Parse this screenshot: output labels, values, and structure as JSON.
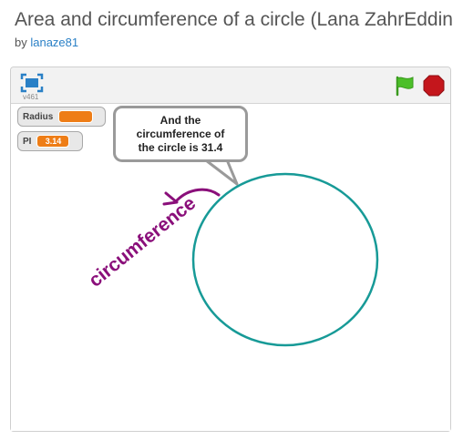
{
  "project": {
    "title": "Area and circumference of a circle (Lana ZahrEddine)",
    "by_prefix": "by ",
    "author": "lanaze81"
  },
  "player": {
    "version": "v461",
    "icons": {
      "fullscreen": "fullscreen-icon",
      "green_flag": "green-flag-icon",
      "stop": "stop-icon"
    }
  },
  "stage": {
    "monitors": [
      {
        "label": "Radius",
        "value": ""
      },
      {
        "label": "PI",
        "value": "3.14"
      }
    ],
    "speech": {
      "line1": "And the",
      "line2": "circumference of",
      "line3": "the circle is 31.4"
    },
    "drawing_label": "circumference",
    "colors": {
      "circle": "#179a97",
      "label": "#8a0f7a",
      "monitor_value": "#ee7d16",
      "flag": "#4cbf29",
      "stop": "#c4161c"
    }
  }
}
